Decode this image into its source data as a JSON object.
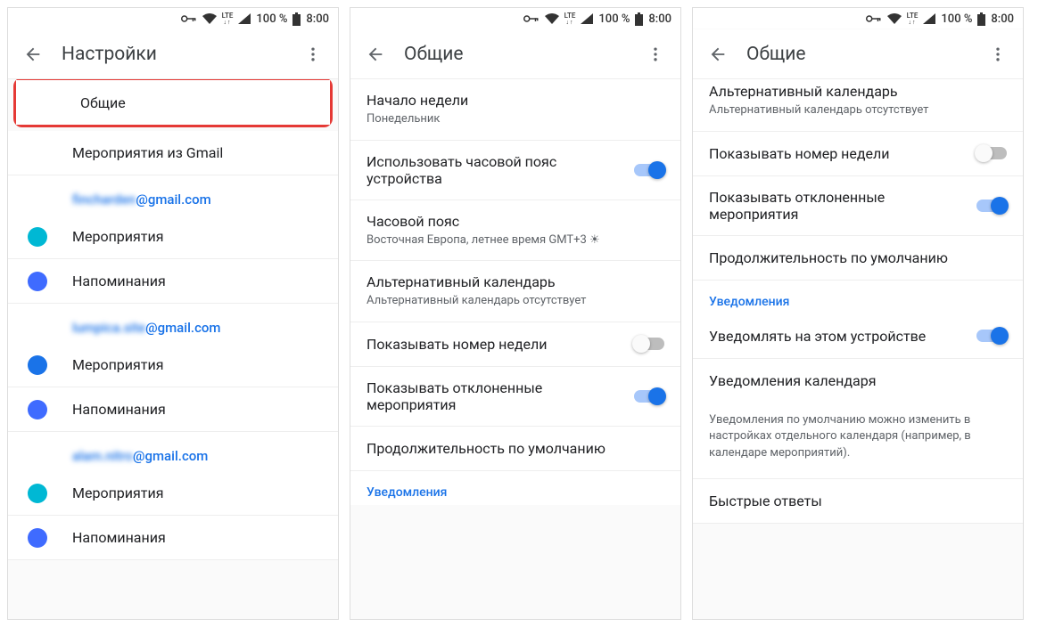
{
  "status": {
    "battery": "100 %",
    "time": "8:00",
    "lte": "LTE"
  },
  "phone1": {
    "title": "Настройки",
    "items": {
      "general": "Общие",
      "gmailEvents": "Мероприятия из Gmail"
    },
    "accounts": [
      {
        "emailPrefix": "fincharden",
        "emailSuffix": "@gmail.com",
        "events": "Мероприятия",
        "eventsColor": "#00b8d4",
        "reminders": "Напоминания",
        "remindersColor": "#3f6bff"
      },
      {
        "emailPrefix": "lumpica.site",
        "emailSuffix": "@gmail.com",
        "events": "Мероприятия",
        "eventsColor": "#1a73e8",
        "reminders": "Напоминания",
        "remindersColor": "#3f6bff"
      },
      {
        "emailPrefix": "alam.nitro",
        "emailSuffix": "@gmail.com",
        "events": "Мероприятия",
        "eventsColor": "#00b8d4",
        "reminders": "Напоминания",
        "remindersColor": "#3f6bff"
      }
    ]
  },
  "phone2": {
    "title": "Общие",
    "weekStart": {
      "title": "Начало недели",
      "value": "Понедельник"
    },
    "useDeviceTz": {
      "title": "Использовать часовой пояс устройства",
      "on": true
    },
    "timeZone": {
      "title": "Часовой пояс",
      "value": "Восточная Европа, летнее время  GMT+3 ☀"
    },
    "altCalendar": {
      "title": "Альтернативный календарь",
      "value": "Альтернативный календарь отсутствует"
    },
    "showWeekNum": {
      "title": "Показывать номер недели",
      "on": false
    },
    "showDeclined": {
      "title": "Показывать отклоненные мероприятия",
      "on": true
    },
    "defaultDuration": "Продолжительность по умолчанию",
    "sectionNotifications": "Уведомления"
  },
  "phone3": {
    "title": "Общие",
    "altCalendar": {
      "title": "Альтернативный календарь",
      "value": "Альтернативный календарь отсутствует"
    },
    "showWeekNum": {
      "title": "Показывать номер недели",
      "on": false
    },
    "showDeclined": {
      "title": "Показывать отклоненные мероприятия",
      "on": true
    },
    "defaultDuration": "Продолжительность по умолчанию",
    "sectionNotifications": "Уведомления",
    "notifyDevice": {
      "title": "Уведомлять на этом устройстве",
      "on": true
    },
    "calendarNotifications": "Уведомления календаря",
    "note": "Уведомления по умолчанию можно изменить в настройках отдельного календаря (например, в календаре мероприятий).",
    "quickReplies": "Быстрые ответы"
  }
}
